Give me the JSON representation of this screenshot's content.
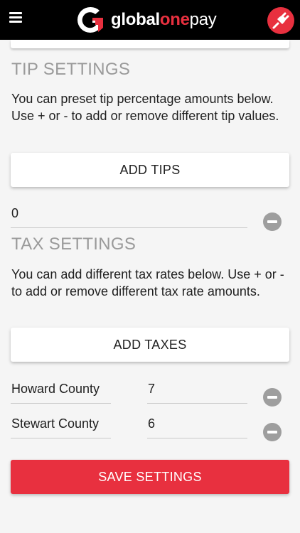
{
  "header": {
    "logo_word1": "global",
    "logo_word2": "one",
    "logo_word3": "pay",
    "menu_icon": "hamburger-menu-icon",
    "action_icon": "plug-icon"
  },
  "tip_settings": {
    "title": "TIP SETTINGS",
    "description": "You can preset tip percentage amounts below. Use + or - to add or remove different tip values.",
    "add_label": "ADD TIPS",
    "rows": [
      {
        "value": "0"
      }
    ]
  },
  "tax_settings": {
    "title": "TAX SETTINGS",
    "description": "You can add different tax rates below. Use + or - to add or remove different tax rate amounts.",
    "add_label": "ADD TAXES",
    "rows": [
      {
        "name": "Howard County",
        "rate": "7"
      },
      {
        "name": "Stewart County",
        "rate": "6"
      }
    ]
  },
  "save_label": "SAVE SETTINGS",
  "colors": {
    "brand_red": "#e8303f",
    "header_bg": "#000000",
    "page_bg": "#f5f5f5"
  }
}
